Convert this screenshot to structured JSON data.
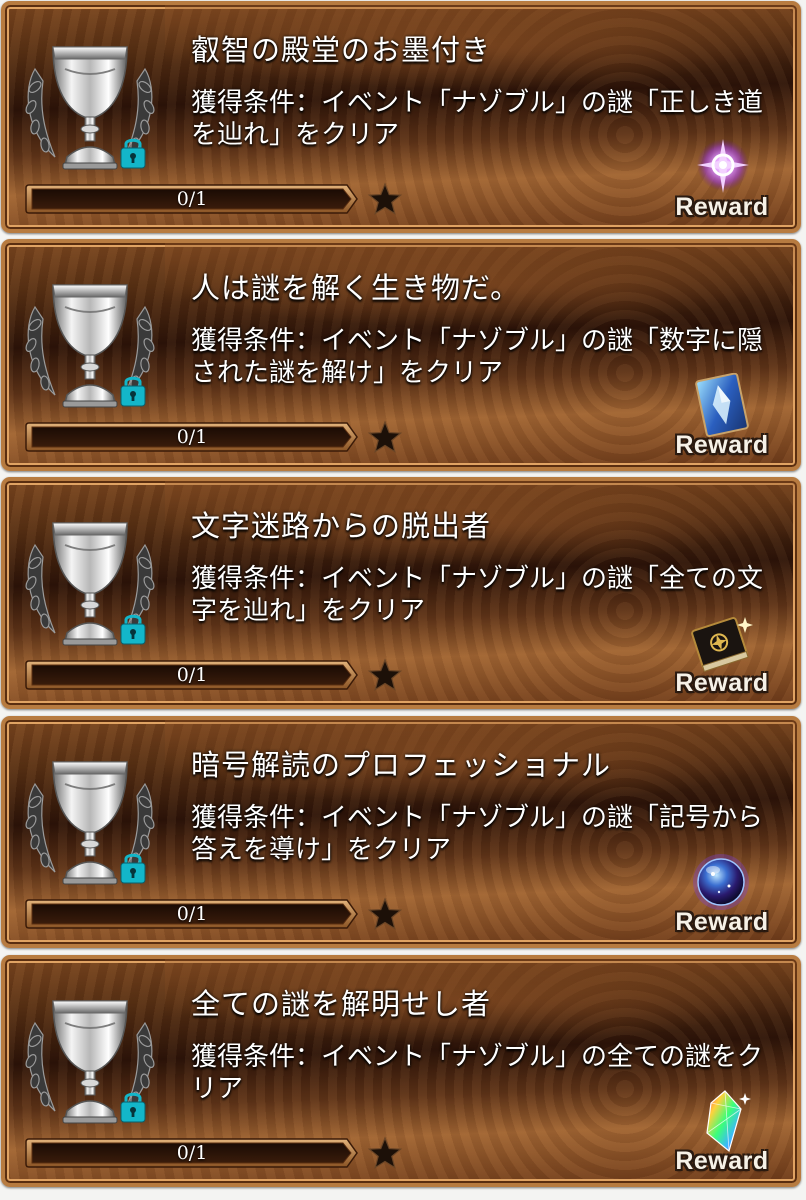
{
  "achievements": [
    {
      "title": "叡智の殿堂のお墨付き",
      "condition": "獲得条件：イベント「ナゾブル」の謎「正しき道を辿れ」をクリア",
      "progress": "0/1",
      "progress_fraction": 0,
      "locked": true,
      "reward_label": "Reward",
      "reward_icon": "purple-sparkle-icon"
    },
    {
      "title": "人は謎を解く生き物だ。",
      "condition": "獲得条件：イベント「ナゾブル」の謎「数字に隠された謎を解け」をクリア",
      "progress": "0/1",
      "progress_fraction": 0,
      "locked": true,
      "reward_label": "Reward",
      "reward_icon": "crystal-card-icon"
    },
    {
      "title": "文字迷路からの脱出者",
      "condition": "獲得条件：イベント「ナゾブル」の謎「全ての文字を辿れ」をクリア",
      "progress": "0/1",
      "progress_fraction": 0,
      "locked": true,
      "reward_label": "Reward",
      "reward_icon": "dark-tome-icon"
    },
    {
      "title": "暗号解読のプロフェッショナル",
      "condition": "獲得条件：イベント「ナゾブル」の謎「記号から答えを導け」をクリア",
      "progress": "0/1",
      "progress_fraction": 0,
      "locked": true,
      "reward_label": "Reward",
      "reward_icon": "cosmic-orb-icon"
    },
    {
      "title": "全ての謎を解明せし者",
      "condition": "獲得条件：イベント「ナゾブル」の全ての謎をクリア",
      "progress": "0/1",
      "progress_fraction": 0,
      "locked": true,
      "reward_label": "Reward",
      "reward_icon": "rainbow-gem-icon"
    }
  ],
  "colors": {
    "frame": "#b77b40",
    "panel_dark": "#2c1308",
    "text": "#ffffff",
    "lock": "#13b6c9",
    "star": "#1c1008"
  }
}
